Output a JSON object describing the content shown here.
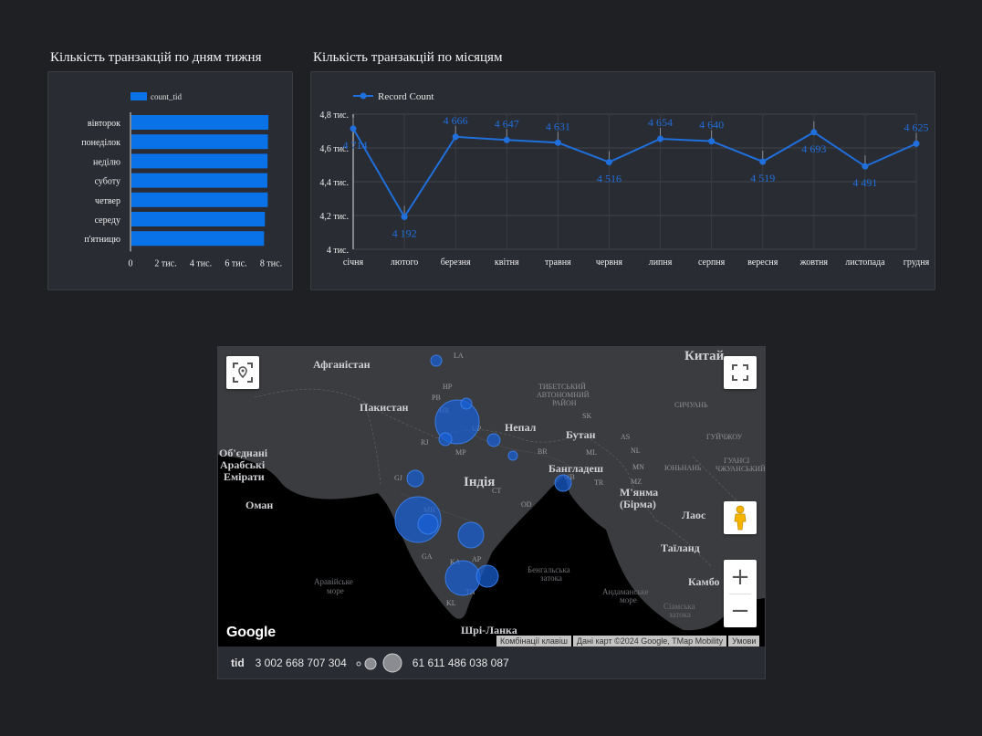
{
  "titles": {
    "weekday": "Кількість транзакцій по дням тижня",
    "monthly": "Кількість транзакцій по місяцям"
  },
  "colors": {
    "accent": "#0a72e8",
    "line": "#1f6fdc",
    "bg": "#1f2024",
    "panel": "#2a2c33"
  },
  "weekday_chart": {
    "type": "bar",
    "orientation": "horizontal",
    "legend": "count_tid",
    "categories": [
      "вівторок",
      "понеділок",
      "неділю",
      "суботу",
      "четвер",
      "середу",
      "п'ятницю"
    ],
    "values": [
      7850,
      7820,
      7800,
      7790,
      7810,
      7650,
      7600
    ],
    "xlim": [
      0,
      8000
    ],
    "x_ticks": [
      {
        "v": 0,
        "label": "0"
      },
      {
        "v": 2000,
        "label": "2 тис."
      },
      {
        "v": 4000,
        "label": "4 тис."
      },
      {
        "v": 6000,
        "label": "6 тис."
      },
      {
        "v": 8000,
        "label": "8 тис."
      }
    ]
  },
  "monthly_chart": {
    "type": "line",
    "legend": "Record Count",
    "categories": [
      "січня",
      "лютого",
      "березня",
      "квітня",
      "травня",
      "червня",
      "липня",
      "серпня",
      "вересня",
      "жовтня",
      "листопада",
      "грудня"
    ],
    "values": [
      4714,
      4192,
      4666,
      4647,
      4631,
      4516,
      4654,
      4640,
      4519,
      4693,
      4491,
      4625
    ],
    "labels": [
      "4 714",
      "4 192",
      "4 666",
      "4 647",
      "4 631",
      "4 516",
      "4 654",
      "4 640",
      "4 519",
      "4 693",
      "4 491",
      "4 625"
    ],
    "ylim": [
      4000,
      4800
    ],
    "y_ticks": [
      {
        "v": 4000,
        "label": "4 тис."
      },
      {
        "v": 4200,
        "label": "4,2 тис."
      },
      {
        "v": 4400,
        "label": "4,4 тис."
      },
      {
        "v": 4600,
        "label": "4,6 тис."
      },
      {
        "v": 4800,
        "label": "4,8 тис."
      }
    ]
  },
  "map": {
    "country_labels": [
      "Афганістан",
      "Китай",
      "Пакистан",
      "Непал",
      "Бутан",
      "Об'єднані",
      "Арабські",
      "Емірати",
      "Індія",
      "Бангладеш",
      "М'янма",
      "(Бірма)",
      "Оман",
      "Лаос",
      "Таїланд",
      "Камбо",
      "Шрі-Ланка"
    ],
    "region_labels": [
      "ТИБЕТСЬКИЙ",
      "АВТОНОМНИЙ",
      "РАЙОН",
      "СИЧУАНЬ",
      "ЮНЬНАНЬ",
      "ГУЙЧЖОУ",
      "ГУАНСІ",
      "ЧЖУАНСЬКИЙ"
    ],
    "water_labels": [
      "Аравійське",
      "море",
      "Бенгальська",
      "затока",
      "Андаманське",
      "море",
      "Сіамська",
      "затока"
    ],
    "state_codes": [
      "LA",
      "HP",
      "PB",
      "HR",
      "UP",
      "RJ",
      "GJ",
      "MP",
      "MH",
      "BR",
      "WB",
      "SK",
      "AS",
      "ML",
      "NL",
      "MN",
      "TR",
      "MZ",
      "OD",
      "CT",
      "GA",
      "KA",
      "AP",
      "TN",
      "KL"
    ],
    "brand": "Google",
    "attribution": [
      "Комбінації клавіш",
      "Дані карт ©2024 Google, TMap Mobility",
      "Умови"
    ]
  },
  "legend": {
    "label": "tid",
    "min": "3 002 668 707 304",
    "max": "61 611 486 038 087"
  }
}
